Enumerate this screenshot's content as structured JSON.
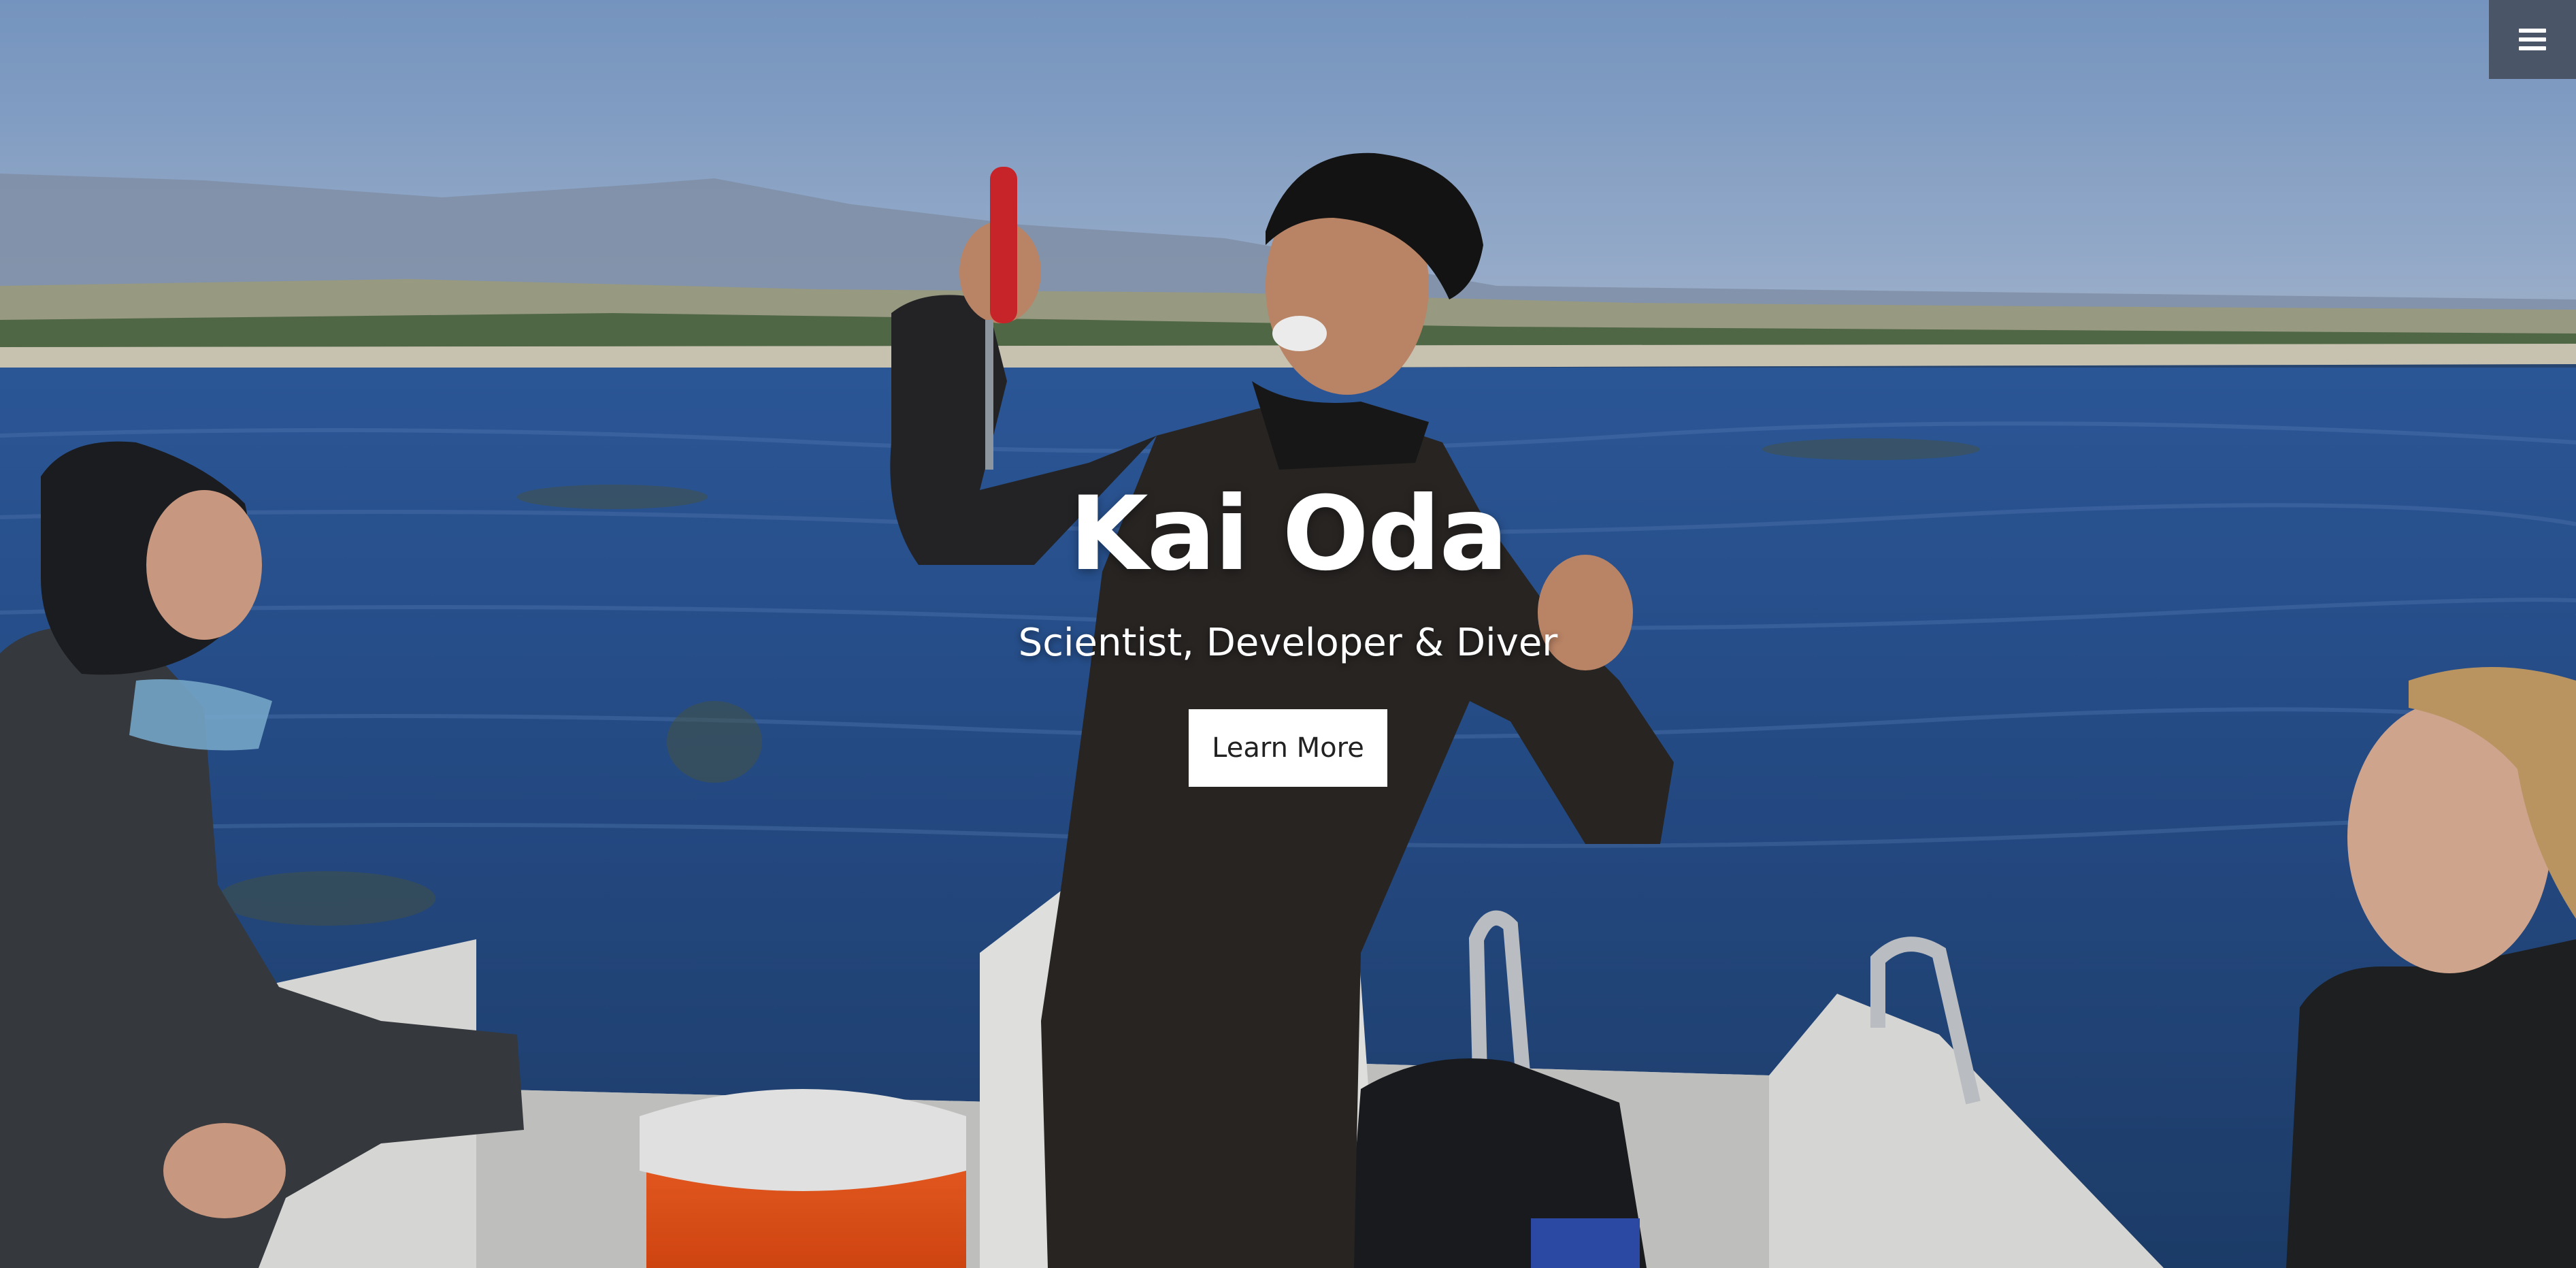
{
  "header": {
    "menu_icon": "hamburger-menu-icon"
  },
  "hero": {
    "title": "Kai Oda",
    "subtitle": "Scientist, Developer & Diver",
    "cta_label": "Learn More",
    "photo": "divers-on-boat-background"
  },
  "colors": {
    "menu_button": "#4a5568",
    "text": "#ffffff",
    "cta_bg": "#ffffff",
    "cta_text": "#222222"
  }
}
